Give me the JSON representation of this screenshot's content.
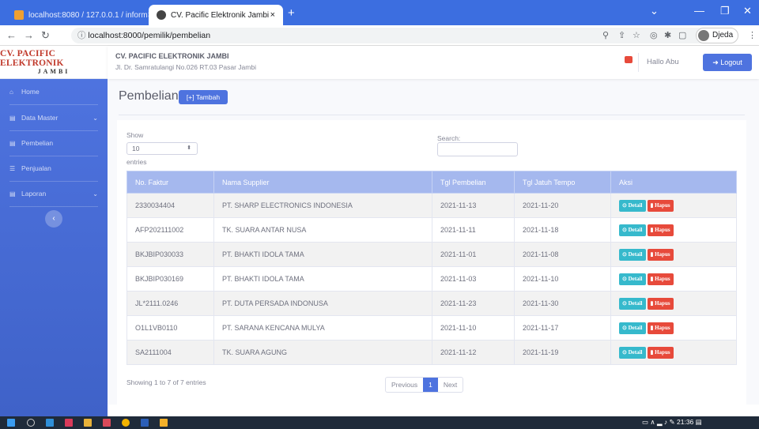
{
  "browser": {
    "tabs": [
      {
        "label": "localhost:8080 / 127.0.0.1 / inform",
        "active": false
      },
      {
        "label": "CV. Pacific Elektronik Jambi",
        "active": true
      }
    ],
    "close_glyph": "×",
    "new_tab_glyph": "+",
    "url": "localhost:8000/pemilik/pembelian",
    "profile_name": "Djeda",
    "window_controls": [
      "⌄",
      "—",
      "❐",
      "✕"
    ]
  },
  "brand": {
    "line1": "CV. PACIFIC ELEKTRONIK",
    "line2": "JAMBI"
  },
  "sidebar": {
    "items": [
      {
        "label": "Home",
        "icon": "home-icon",
        "has_caret": false
      },
      {
        "label": "Data Master",
        "icon": "folder-icon",
        "has_caret": true
      },
      {
        "label": "Pembelian",
        "icon": "cart-icon",
        "has_caret": false
      },
      {
        "label": "Penjualan",
        "icon": "list-icon",
        "has_caret": false
      },
      {
        "label": "Laporan",
        "icon": "folder-icon",
        "has_caret": true
      }
    ],
    "toggle_glyph": "‹"
  },
  "topbar": {
    "company_name": "CV. PACIFIC ELEKTRONIK JAMBI",
    "company_address": "Jl. Dr. Samratulangi No.026 RT.03 Pasar Jambi",
    "greeting": "Hallo Abu",
    "logout_label": "➜ Logout"
  },
  "page": {
    "title": "Pembelian",
    "add_button": "[+] Tambah"
  },
  "table_controls": {
    "show_label": "Show",
    "length_value": "10",
    "entries_label": "entries",
    "search_label": "Search:",
    "search_value": ""
  },
  "table": {
    "columns": [
      "No. Faktur",
      "Nama Supplier",
      "Tgl Pembelian",
      "Tgl Jatuh Tempo",
      "Aksi"
    ],
    "detail_label": "⊙ Detail",
    "delete_label": "▮ Hapus",
    "rows": [
      [
        "2330034404",
        "PT. SHARP ELECTRONICS INDONESIA",
        "2021-11-13",
        "2021-11-20"
      ],
      [
        "AFP202111002",
        "TK. SUARA ANTAR NUSA",
        "2021-11-11",
        "2021-11-18"
      ],
      [
        "BKJBIP030033",
        "PT. BHAKTI IDOLA TAMA",
        "2021-11-01",
        "2021-11-08"
      ],
      [
        "BKJBIP030169",
        "PT. BHAKTI IDOLA TAMA",
        "2021-11-03",
        "2021-11-10"
      ],
      [
        "JL*2111.0246",
        "PT. DUTA PERSADA INDONUSA",
        "2021-11-23",
        "2021-11-30"
      ],
      [
        "O1L1VB0110",
        "PT. SARANA KENCANA MULYA",
        "2021-11-10",
        "2021-11-17"
      ],
      [
        "SA2111004",
        "TK. SUARA AGUNG",
        "2021-11-12",
        "2021-11-19"
      ]
    ]
  },
  "pagination": {
    "info": "Showing 1 to 7 of 7 entries",
    "previous": "Previous",
    "current": "1",
    "next": "Next"
  },
  "taskbar": {
    "time": "21:36"
  },
  "colors": {
    "primary": "#4e73df",
    "info": "#36b9cc",
    "danger": "#e74a3b",
    "table_header": "#a5b8ee"
  }
}
